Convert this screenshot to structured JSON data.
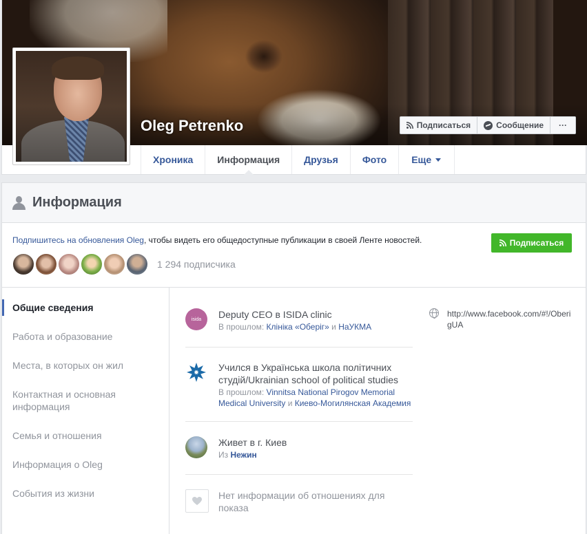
{
  "profile": {
    "name": "Oleg Petrenko",
    "cover_actions": {
      "subscribe_label": "Подписаться",
      "message_label": "Сообщение",
      "more_label": "···"
    },
    "tabs": [
      {
        "label": "Хроника"
      },
      {
        "label": "Информация"
      },
      {
        "label": "Друзья"
      },
      {
        "label": "Фото"
      },
      {
        "label": "Еще"
      }
    ],
    "active_tab": "Информация"
  },
  "info": {
    "title": "Информация",
    "follow": {
      "text_link": "Подпишитесь на обновления Oleg",
      "text_rest": ", чтобы видеть его общедоступные публикации в своей Ленте новостей.",
      "button_label": "Подписаться",
      "followers_count": "1 294 подписчика",
      "avatar_count": 6
    },
    "nav": [
      {
        "label": "Общие сведения"
      },
      {
        "label": "Работа и образование"
      },
      {
        "label": "Места, в которых он жил"
      },
      {
        "label": "Контактная и основная информация"
      },
      {
        "label": "Семья и отношения"
      },
      {
        "label": "Информация о Oleg"
      },
      {
        "label": "События из жизни"
      }
    ],
    "active_nav": "Общие сведения",
    "entries": {
      "work": {
        "title": "Deputy CEO в ISIDA clinic",
        "sub_prefix": "В прошлом: ",
        "sub_link1": "Клініка «Оберіг»",
        "sub_and": " и ",
        "sub_link2": "НаУКМА",
        "icon_text": "isida"
      },
      "education": {
        "title": "Учился в Українська школа політичних студій/Ukrainian school of political studies",
        "sub_prefix": "В прошлом: ",
        "sub_link1": "Vinnitsa National Pirogov Memorial Medical University",
        "sub_and": " и ",
        "sub_link2": "Киево-Могилянская Академия"
      },
      "lives": {
        "title": "Живет в г. Киев",
        "sub_prefix": "Из ",
        "sub_link": "Нежин"
      },
      "relationship": {
        "title": "Нет информации об отношениях для показа"
      }
    },
    "website": "http://www.facebook.com/#!/OberigUA"
  },
  "colors": {
    "link": "#365899",
    "green_button": "#42b72a",
    "muted": "#90949c",
    "active_bar": "#4267b2"
  }
}
